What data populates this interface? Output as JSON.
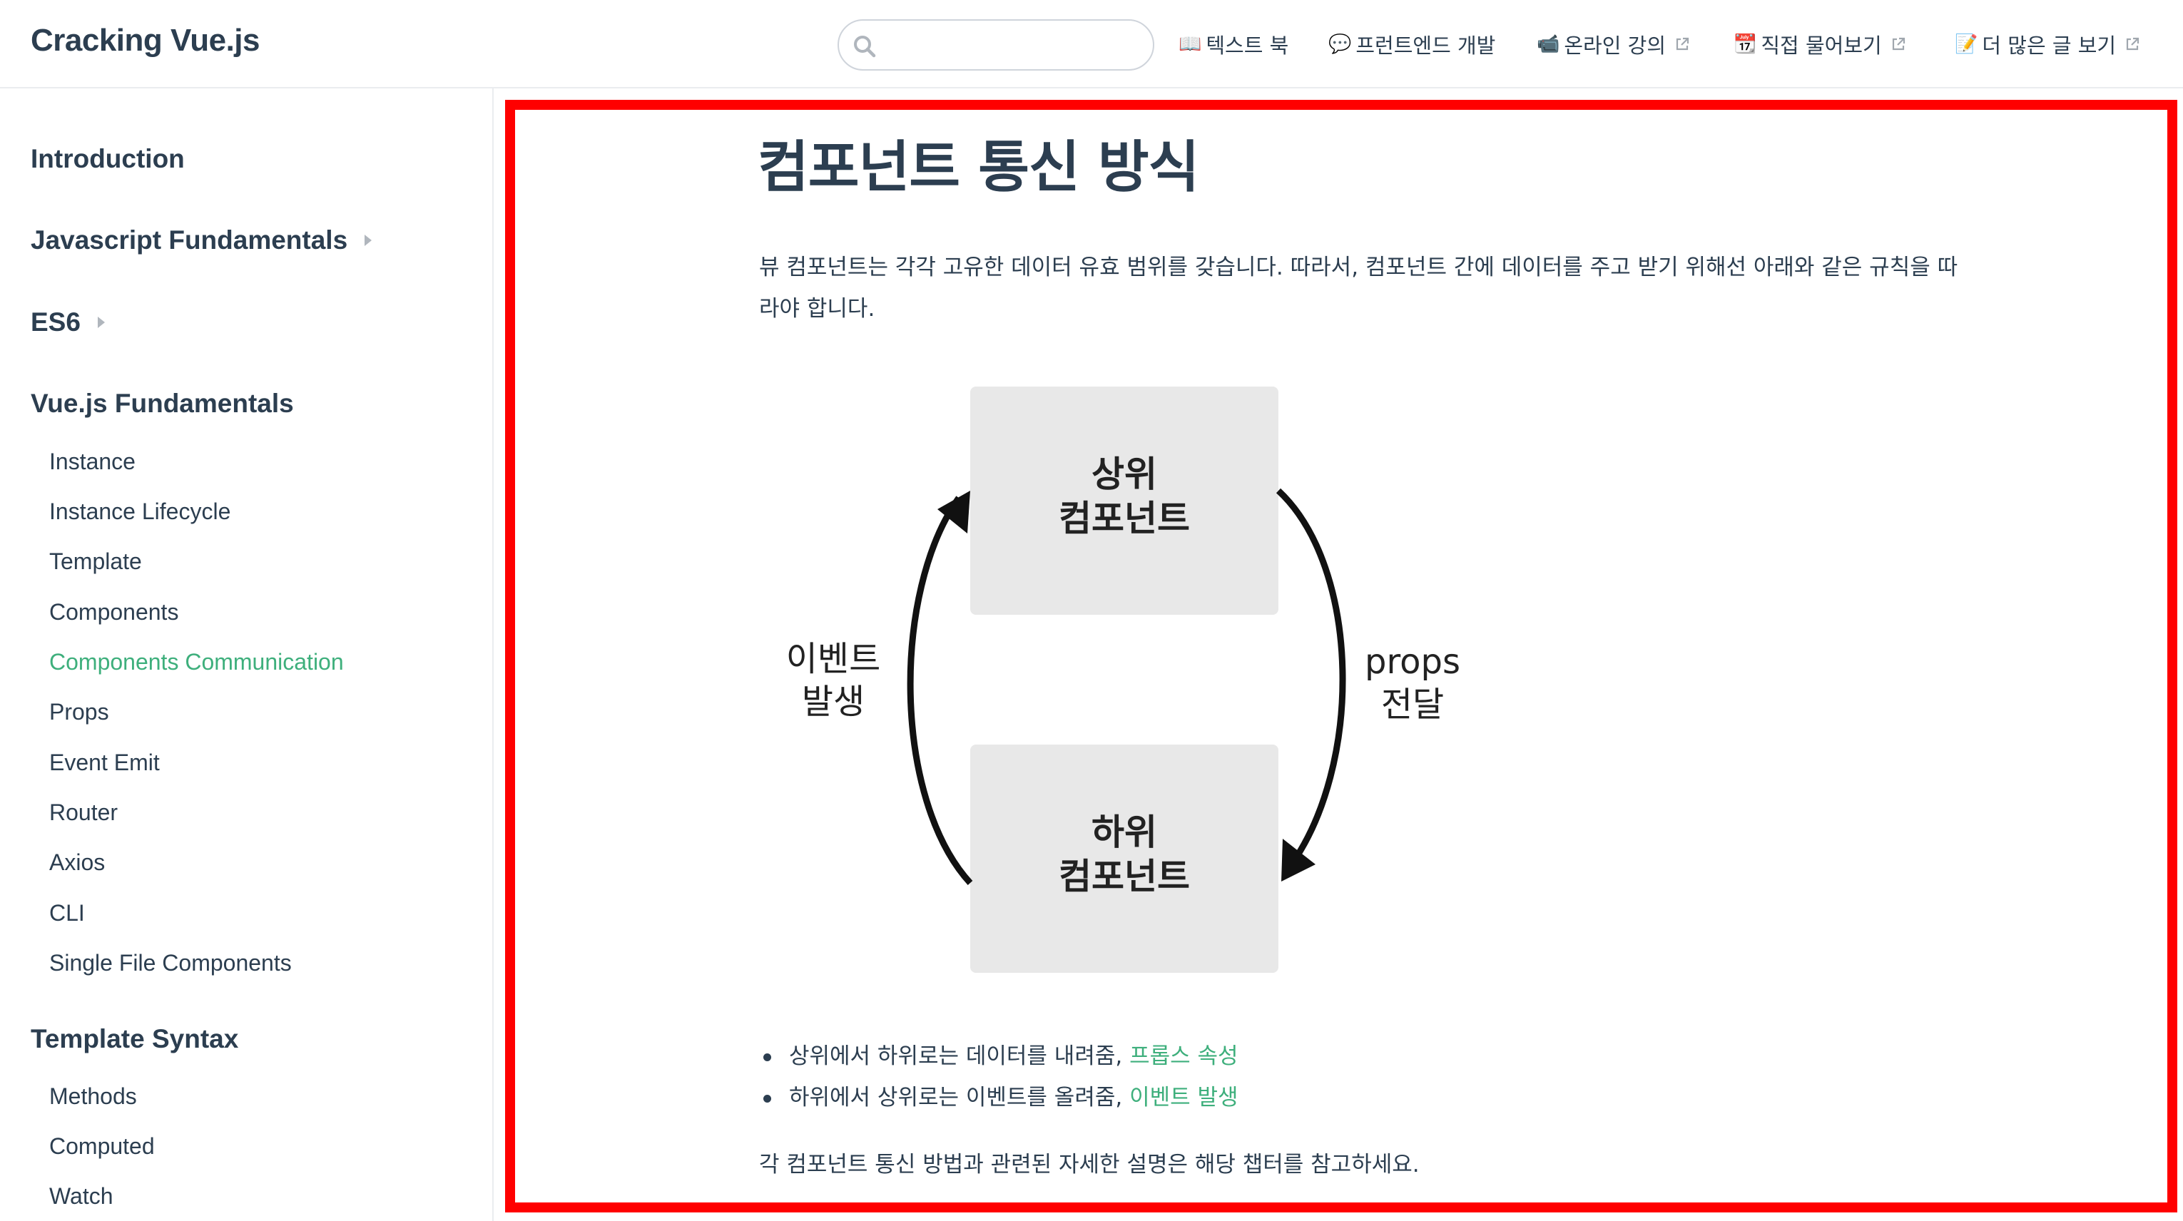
{
  "navbar": {
    "site_name": "Cracking Vue.js",
    "search": {
      "value": "",
      "placeholder": ""
    },
    "items": [
      {
        "emoji": "📖",
        "label": "텍스트 북",
        "external": false
      },
      {
        "emoji": "💬",
        "label": "프런트엔드 개발",
        "external": false
      },
      {
        "emoji": "📹",
        "label": "온라인 강의",
        "external": true
      },
      {
        "emoji": "📆",
        "label": "직접 물어보기",
        "external": true
      },
      {
        "emoji": "📝",
        "label": "더 많은 글 보기",
        "external": true
      }
    ]
  },
  "sidebar": {
    "sections": [
      {
        "title": "Introduction"
      },
      {
        "title": "Javascript Fundamentals"
      },
      {
        "title": "ES6"
      },
      {
        "title": "Vue.js Fundamentals",
        "links": [
          "Instance",
          "Instance Lifecycle",
          "Template",
          "Components",
          "Components Communication",
          "Props",
          "Event Emit",
          "Router",
          "Axios",
          "CLI",
          "Single File Components"
        ]
      },
      {
        "title": "Template Syntax",
        "links": [
          "Methods",
          "Computed",
          "Watch"
        ]
      }
    ],
    "active_link": "Components Communication"
  },
  "content": {
    "title": "컴포넌트 통신 방식",
    "intro": "뷰 컴포넌트는 각각 고유한 데이터 유효 범위를 갖습니다. 따라서, 컴포넌트 간에 데이터를 주고 받기 위해선 아래와 같은 규칙을 따라야 합니다.",
    "diagram": {
      "parent_line1": "상위",
      "parent_line2": "컴포넌트",
      "child_line1": "하위",
      "child_line2": "컴포넌트",
      "left_line1": "이벤트",
      "left_line2": "발생",
      "right_line1": "props",
      "right_line2": "전달"
    },
    "bullets": [
      {
        "text": "상위에서 하위로는 데이터를 내려줌, ",
        "link": "프롭스 속성"
      },
      {
        "text": "하위에서 상위로는 이벤트를 올려줌, ",
        "link": "이벤트 발생"
      }
    ],
    "outro": "각 컴포넌트 통신 방법과 관련된 자세한 설명은 해당 챕터를 참고하세요."
  },
  "colors": {
    "accent": "#3eaf7c",
    "text": "#2c3e50",
    "highlight_frame": "#ff0000",
    "diagram_box": "#e8e8e8"
  }
}
